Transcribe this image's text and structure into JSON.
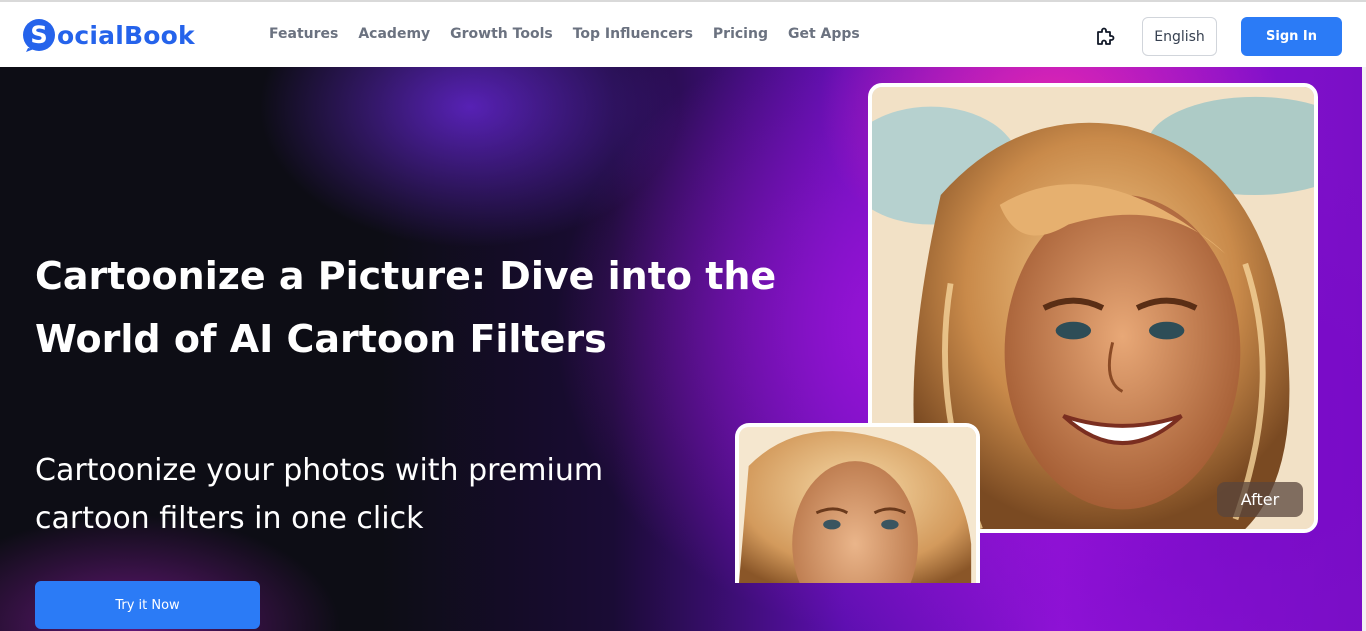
{
  "brand": {
    "name": "ocialBook",
    "accent": "#2563eb"
  },
  "nav": {
    "items": [
      {
        "label": "Features"
      },
      {
        "label": "Academy"
      },
      {
        "label": "Growth Tools"
      },
      {
        "label": "Top Influencers"
      },
      {
        "label": "Pricing"
      },
      {
        "label": "Get Apps"
      }
    ],
    "extension_icon": "puzzle-icon",
    "language_label": "English",
    "signin_label": "Sign In"
  },
  "hero": {
    "headline_line1": "Cartoonize a Picture: Dive into the",
    "headline_line2": "World of AI Cartoon Filters",
    "subhead_line1": "Cartoonize your photos with premium",
    "subhead_line2": "cartoon filters in one click",
    "cta_label": "Try it Now",
    "after_label": "After"
  },
  "colors": {
    "button_blue": "#2b7bf6",
    "hero_dark": "#0d0d15",
    "hero_purple": "#8f12d6",
    "hero_pink": "#ec28aa"
  }
}
